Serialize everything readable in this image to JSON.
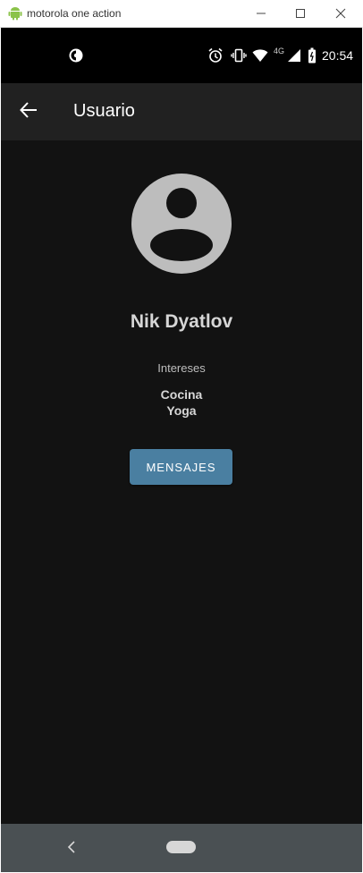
{
  "window": {
    "title": "motorola one action",
    "minimize_glyph": "—",
    "maximize_glyph": "☐",
    "close_glyph": "✕"
  },
  "status_bar": {
    "time": "20:54",
    "network_label": "4G",
    "icons": [
      "data-saver-icon",
      "alarm-icon",
      "vibrate-icon",
      "wifi-icon",
      "signal-icon",
      "battery-icon"
    ]
  },
  "app_bar": {
    "title": "Usuario",
    "back_icon": "arrow-back-icon"
  },
  "profile": {
    "avatar_icon": "account-circle-icon",
    "name": "Nik Dyatlov",
    "interests_label": "Intereses",
    "interests": [
      "Cocina",
      "Yoga"
    ],
    "messages_button": "MENSAJES"
  },
  "nav_bar": {
    "icons": [
      "nav-back-icon",
      "nav-home-pill"
    ]
  },
  "colors": {
    "background": "#121212",
    "app_bar": "#212121",
    "button": "#4a7fa1",
    "nav_bar": "#4a5053",
    "avatar": "#bdbdbd"
  }
}
